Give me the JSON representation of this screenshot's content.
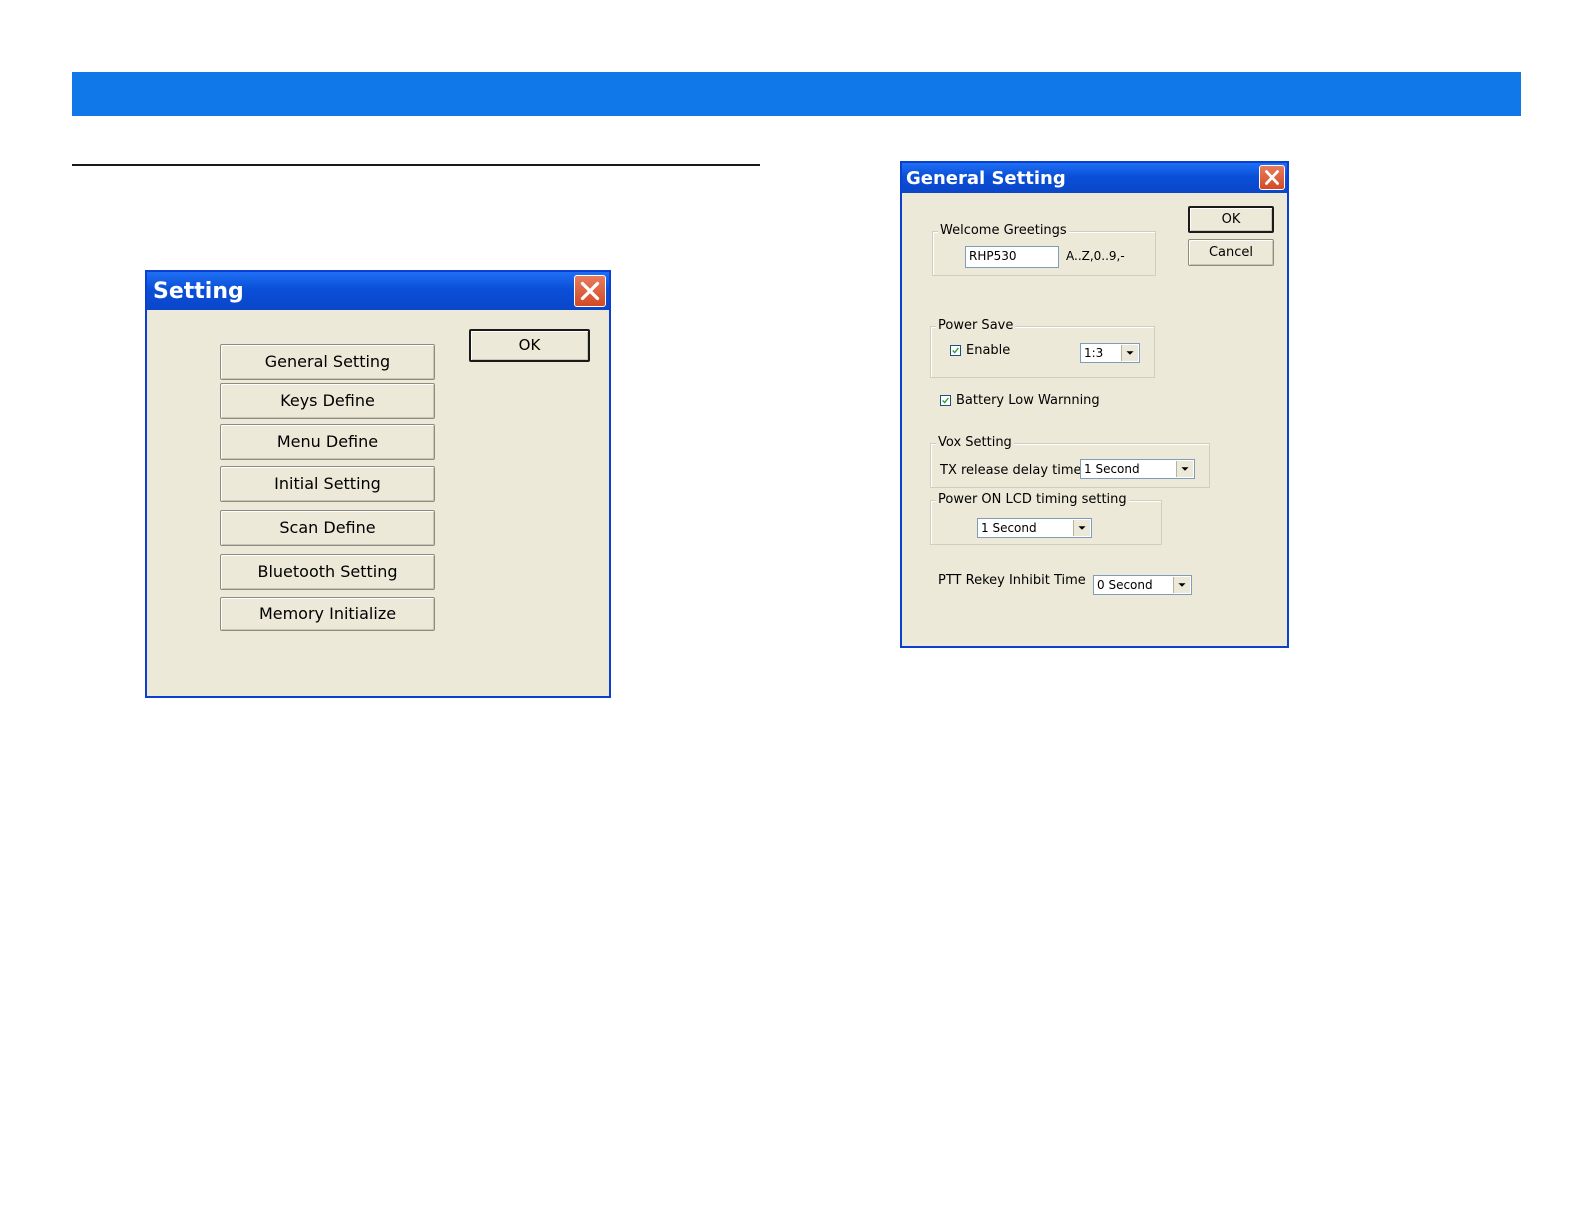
{
  "setting_dialog": {
    "title": "Setting",
    "ok_label": "OK",
    "buttons": [
      "General Setting",
      "Keys Define",
      "Menu Define",
      "Initial Setting",
      "Scan Define",
      "Bluetooth Setting",
      "Memory Initialize"
    ]
  },
  "general_dialog": {
    "title": "General Setting",
    "ok_label": "OK",
    "cancel_label": "Cancel",
    "welcome": {
      "group_label": "Welcome Greetings",
      "value": "RHP530",
      "hint": "A..Z,0..9,-"
    },
    "power_save": {
      "group_label": "Power Save",
      "enable_label": "Enable",
      "enable_checked": true,
      "ratio": "1:3"
    },
    "battery_low": {
      "label": "Battery Low Warnning",
      "checked": true
    },
    "vox": {
      "group_label": "Vox Setting",
      "delay_label": "TX release delay time",
      "delay_value": "1 Second"
    },
    "lcd": {
      "group_label": "Power ON LCD timing setting",
      "value": "1 Second"
    },
    "ptt": {
      "label": "PTT Rekey Inhibit Time",
      "value": "0 Second"
    }
  },
  "colors": {
    "band": "#1078e8",
    "dialog_bg": "#ece9d8",
    "title_blue": "#0a4fd8",
    "close_red": "#d24a26"
  }
}
